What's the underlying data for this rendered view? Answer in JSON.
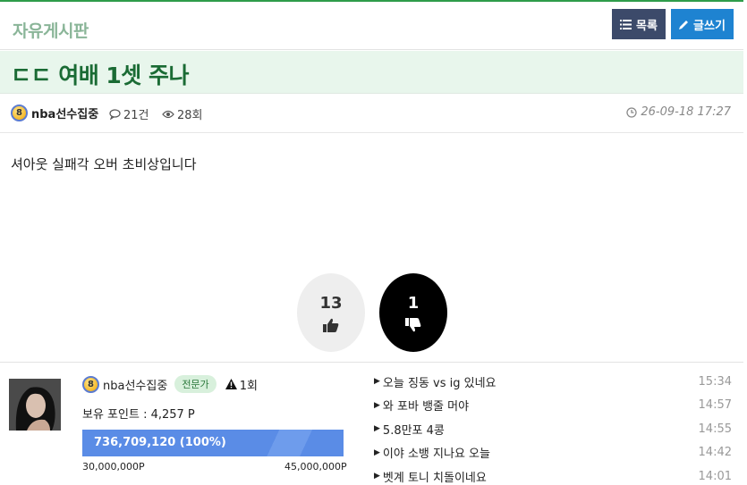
{
  "header": {
    "board_title": "자유게시판",
    "list_button": "목록",
    "write_button": "글쓰기"
  },
  "post": {
    "title": "ㄷㄷ 여배 1셋 주나",
    "author": "nba선수집중",
    "author_level": "8",
    "comment_count": "21건",
    "view_count": "28회",
    "date": "26-09-18 17:27",
    "body": "셔아웃 실패각 오버 초비상입니다"
  },
  "votes": {
    "up": "13",
    "down": "1"
  },
  "profile": {
    "name": "nba선수집중",
    "level": "8",
    "tag": "전문가",
    "warnings": "1회",
    "points": "보유 포인트 : 4,257 P",
    "progress_label": "736,709,120 (100%)",
    "progress_percent": 100,
    "progress_min": "30,000,000P",
    "progress_max": "45,000,000P"
  },
  "recent_posts": [
    {
      "title": "오늘 징동 vs ig 있네요",
      "time": "15:34"
    },
    {
      "title": "와 포바 뱅줄 머야",
      "time": "14:57"
    },
    {
      "title": "5.8만포 4콩",
      "time": "14:55"
    },
    {
      "title": "이야 소뱅 지나요 오늘",
      "time": "14:42"
    },
    {
      "title": "벳계 토니 치돌이네요",
      "time": "14:01"
    }
  ],
  "colors": {
    "accent_green": "#2e9c4a",
    "list_button_bg": "#3c4a6a",
    "write_button_bg": "#1e83d1",
    "progress_bar": "#5a8ce6"
  },
  "icons": {
    "list": "list-icon",
    "write": "pencil-icon",
    "comment": "comment-icon",
    "view": "eye-icon",
    "clock": "clock-icon",
    "thumbs_up": "thumbs-up-icon",
    "thumbs_down": "thumbs-down-icon",
    "warning": "warning-icon"
  }
}
